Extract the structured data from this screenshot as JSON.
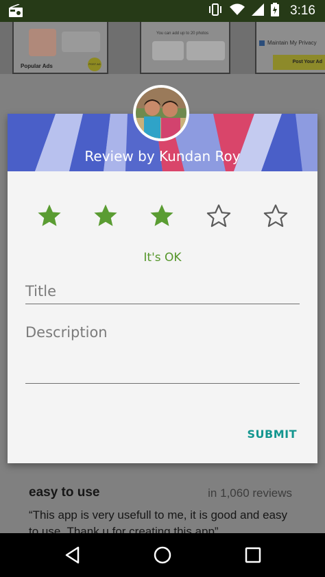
{
  "status_bar": {
    "time": "3:16",
    "icons": [
      "radio-icon",
      "vibrate-icon",
      "wifi-icon",
      "signal-icon",
      "battery-icon"
    ]
  },
  "background": {
    "popular_ads_label": "Popular Ads",
    "post_ad_small": "POST AD",
    "upload_hint": "You can add up to 20 photos",
    "maintain_privacy": "Maintain My Privacy",
    "post_ad_button": "Post Your Ad",
    "review_title": "easy to use",
    "review_count": "in 1,060 reviews",
    "review_quote": "“This app is very usefull to me, it is good and easy to use. Thank u for creating this app”"
  },
  "dialog": {
    "title": "Review by Kundan Roy",
    "rating": 3,
    "max_rating": 5,
    "rating_label": "It's OK",
    "title_placeholder": "Title",
    "title_value": "",
    "description_placeholder": "Description",
    "description_value": "",
    "submit_label": "SUBMIT"
  },
  "colors": {
    "star_filled": "#5a9c32",
    "rating_label": "#55962a",
    "submit": "#13968f",
    "banner_blue": "#4a5fc8",
    "banner_pink": "#d9456a"
  },
  "nav_bar": {
    "icons": [
      "back-icon",
      "home-icon",
      "recents-icon"
    ]
  }
}
